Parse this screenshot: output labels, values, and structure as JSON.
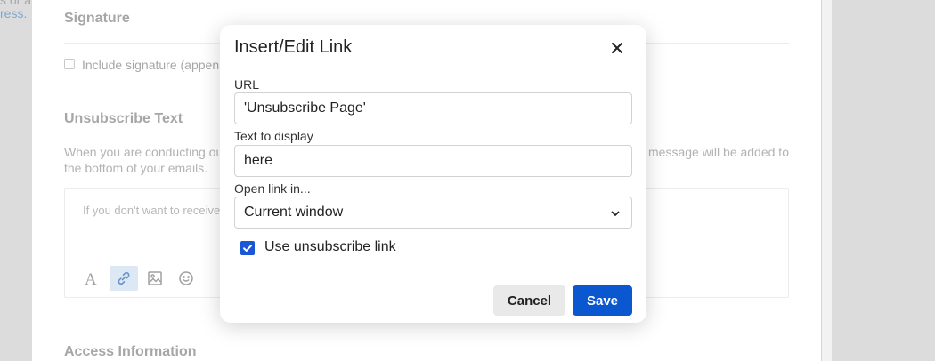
{
  "background": {
    "left_fragment_top": "s or a",
    "left_fragment_link": "ress.",
    "signature": {
      "title": "Signature",
      "checkbox_label": "Include signature (appen"
    },
    "unsubscribe": {
      "title": "Unsubscribe Text",
      "description_left_line1": "When you are conducting ou",
      "description_left_line2": "the bottom of your emails.",
      "description_right_line1": "message will be added to",
      "editor_text": "If you don't want to receive"
    },
    "access": {
      "title": "Access Information"
    },
    "toolbar_icons": [
      "font-icon",
      "link-icon",
      "image-icon",
      "emoji-icon"
    ]
  },
  "modal": {
    "title": "Insert/Edit Link",
    "url_label": "URL",
    "url_value": "'Unsubscribe Page'",
    "text_label": "Text to display",
    "text_value": "here",
    "open_label": "Open link in...",
    "open_value": "Current window",
    "checkbox_label": "Use unsubscribe link",
    "checkbox_checked": true,
    "cancel_label": "Cancel",
    "save_label": "Save",
    "accent_color": "#0b57d0"
  }
}
